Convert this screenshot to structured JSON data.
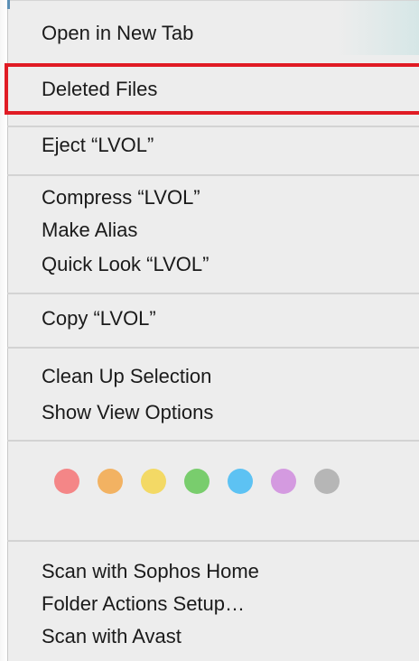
{
  "menu": {
    "items": {
      "open_new_tab": "Open in New Tab",
      "deleted_files": "Deleted Files",
      "eject": "Eject “LVOL”",
      "compress": "Compress “LVOL”",
      "make_alias": "Make Alias",
      "quick_look": "Quick Look “LVOL”",
      "copy": "Copy “LVOL”",
      "clean_up": "Clean Up Selection",
      "view_options": "Show View Options",
      "scan_sophos": "Scan with Sophos Home",
      "folder_actions": "Folder Actions Setup…",
      "scan_avast": "Scan with Avast"
    },
    "tag_colors": {
      "red": "#f48687",
      "orange": "#f2b262",
      "yellow": "#f3d965",
      "green": "#79cd6d",
      "blue": "#5dc2f3",
      "purple": "#d49ae0",
      "gray": "#b6b6b6"
    },
    "highlight_color": "#e01b24"
  }
}
